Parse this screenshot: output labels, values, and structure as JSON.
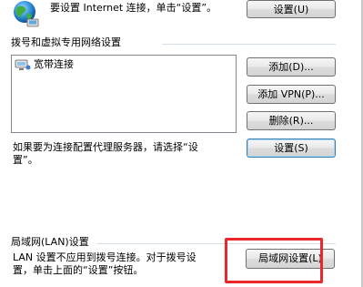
{
  "top_notice": {
    "text": "要设置 Internet 连接，单击“设置”。",
    "button": "设置(U)"
  },
  "dialup": {
    "group_label": "拨号和虚拟专用网络设置",
    "connections": [
      {
        "name": "宽带连接",
        "icon": "broadband-connection-icon"
      }
    ],
    "buttons": {
      "add": "添加(D)...",
      "add_vpn": "添加 VPN(P)...",
      "delete": "删除(R)...",
      "settings": "设置(S)"
    },
    "proxy_note_line1": "如果要为连接配置代理服务器，请选择“设",
    "proxy_note_line2": "置”。"
  },
  "lan": {
    "group_label": "局域网(LAN)设置",
    "note_line1": "LAN 设置不应用到拨号连接。对于拨号设",
    "note_line2": "置，单击上面的“设置”按钮。",
    "button": "局域网设置(L)"
  },
  "colors": {
    "highlight": "#e8282c",
    "focus_border": "#3c7fb1"
  }
}
